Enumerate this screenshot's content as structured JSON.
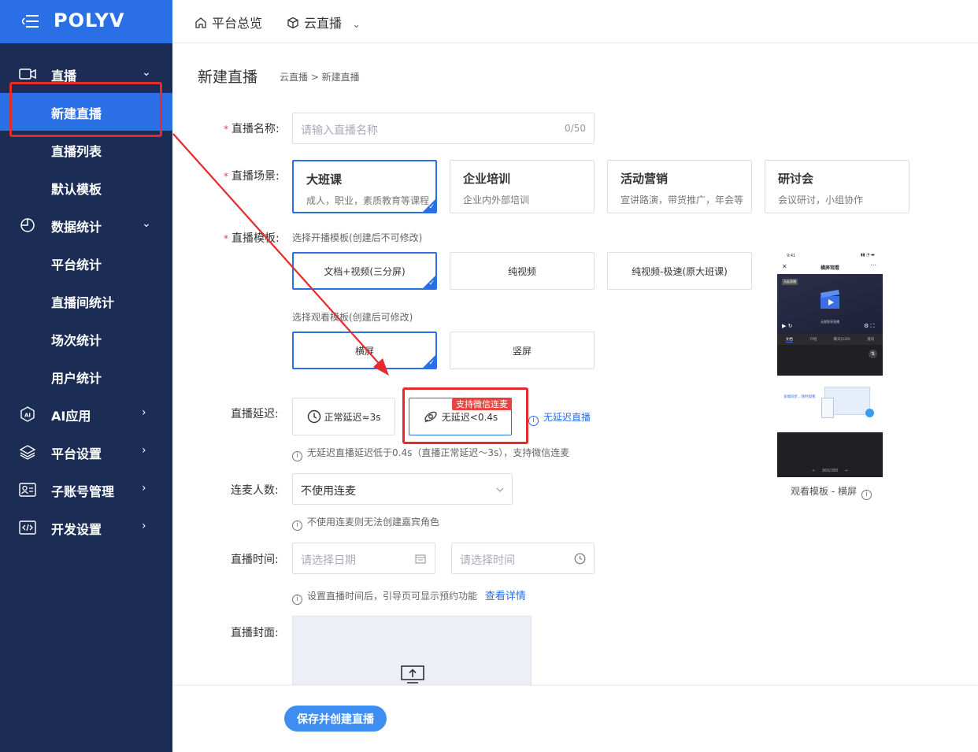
{
  "brand": {
    "logo": "POLYV",
    "accent": "#2b6fe6",
    "sidebar_bg": "#1b2d55"
  },
  "sidebar": {
    "items": [
      {
        "label": "直播",
        "icon": "video-camera-icon",
        "chevron": "⌄"
      },
      {
        "label": "新建直播"
      },
      {
        "label": "直播列表"
      },
      {
        "label": "默认模板"
      },
      {
        "label": "数据统计",
        "icon": "pie-chart-icon",
        "chevron": "⌄"
      },
      {
        "label": "平台统计"
      },
      {
        "label": "直播间统计"
      },
      {
        "label": "场次统计"
      },
      {
        "label": "用户统计"
      },
      {
        "label": "AI应用",
        "icon": "ai-hexagon-icon",
        "chevron": "›"
      },
      {
        "label": "平台设置",
        "icon": "layers-icon",
        "chevron": "›"
      },
      {
        "label": "子账号管理",
        "icon": "id-card-icon",
        "chevron": "›"
      },
      {
        "label": "开发设置",
        "icon": "code-icon",
        "chevron": "›"
      }
    ]
  },
  "topbar": {
    "home": {
      "label": "平台总览",
      "icon": "home-icon"
    },
    "product": {
      "label": "云直播",
      "icon": "cube-icon",
      "chevron": "⌄"
    }
  },
  "page": {
    "title": "新建直播",
    "breadcrumb": "云直播 >  新建直播"
  },
  "form": {
    "name": {
      "label": "直播名称:",
      "placeholder": "请输入直播名称",
      "counter": "0/50"
    },
    "scene": {
      "label": "直播场景:",
      "options": [
        {
          "title": "大班课",
          "desc": "成人，职业，素质教育等课程"
        },
        {
          "title": "企业培训",
          "desc": "企业内外部培训"
        },
        {
          "title": "活动营销",
          "desc": "宣讲路演，带货推广，年会等"
        },
        {
          "title": "研讨会",
          "desc": "会议研讨，小组协作"
        }
      ]
    },
    "template": {
      "label": "直播模板:",
      "broadcast_hint": "选择开播模板(创建后不可修改)",
      "broadcast_options": [
        "文档+视频(三分屏)",
        "纯视频",
        "纯视频-极速(原大班课)"
      ],
      "viewer_hint": "选择观看模板(创建后可修改)",
      "viewer_options": [
        "横屏",
        "竖屏"
      ]
    },
    "delay": {
      "label": "直播延迟:",
      "normal": "正常延迟≈3s",
      "low": "无延迟<0.4s",
      "badge": "支持微信连麦",
      "link": "无延迟直播",
      "hint": "无延迟直播延迟低于0.4s（直播正常延迟～3s），支持微信连麦"
    },
    "mic": {
      "label": "连麦人数:",
      "value": "不使用连麦",
      "hint": "不使用连麦则无法创建嘉宾角色"
    },
    "time": {
      "label": "直播时间:",
      "date_placeholder": "请选择日期",
      "time_placeholder": "请选择时间",
      "hint": "设置直播时间后，引导页可显示预约功能",
      "link": "查看详情"
    },
    "cover": {
      "label": "直播封面:"
    }
  },
  "preview": {
    "caption": "观看模板 - 横屏",
    "status_time": "9:41",
    "phone_title": "横屏观看",
    "live_tag": "无延直播",
    "video_caption": "无限智享直播",
    "tabs": [
      "文档",
      "介绍",
      "聊天(120)",
      "提问"
    ],
    "promo_text": "多端同步，随时观看",
    "page_indicator": "360/380"
  },
  "footer": {
    "save_label": "保存并创建直播"
  }
}
